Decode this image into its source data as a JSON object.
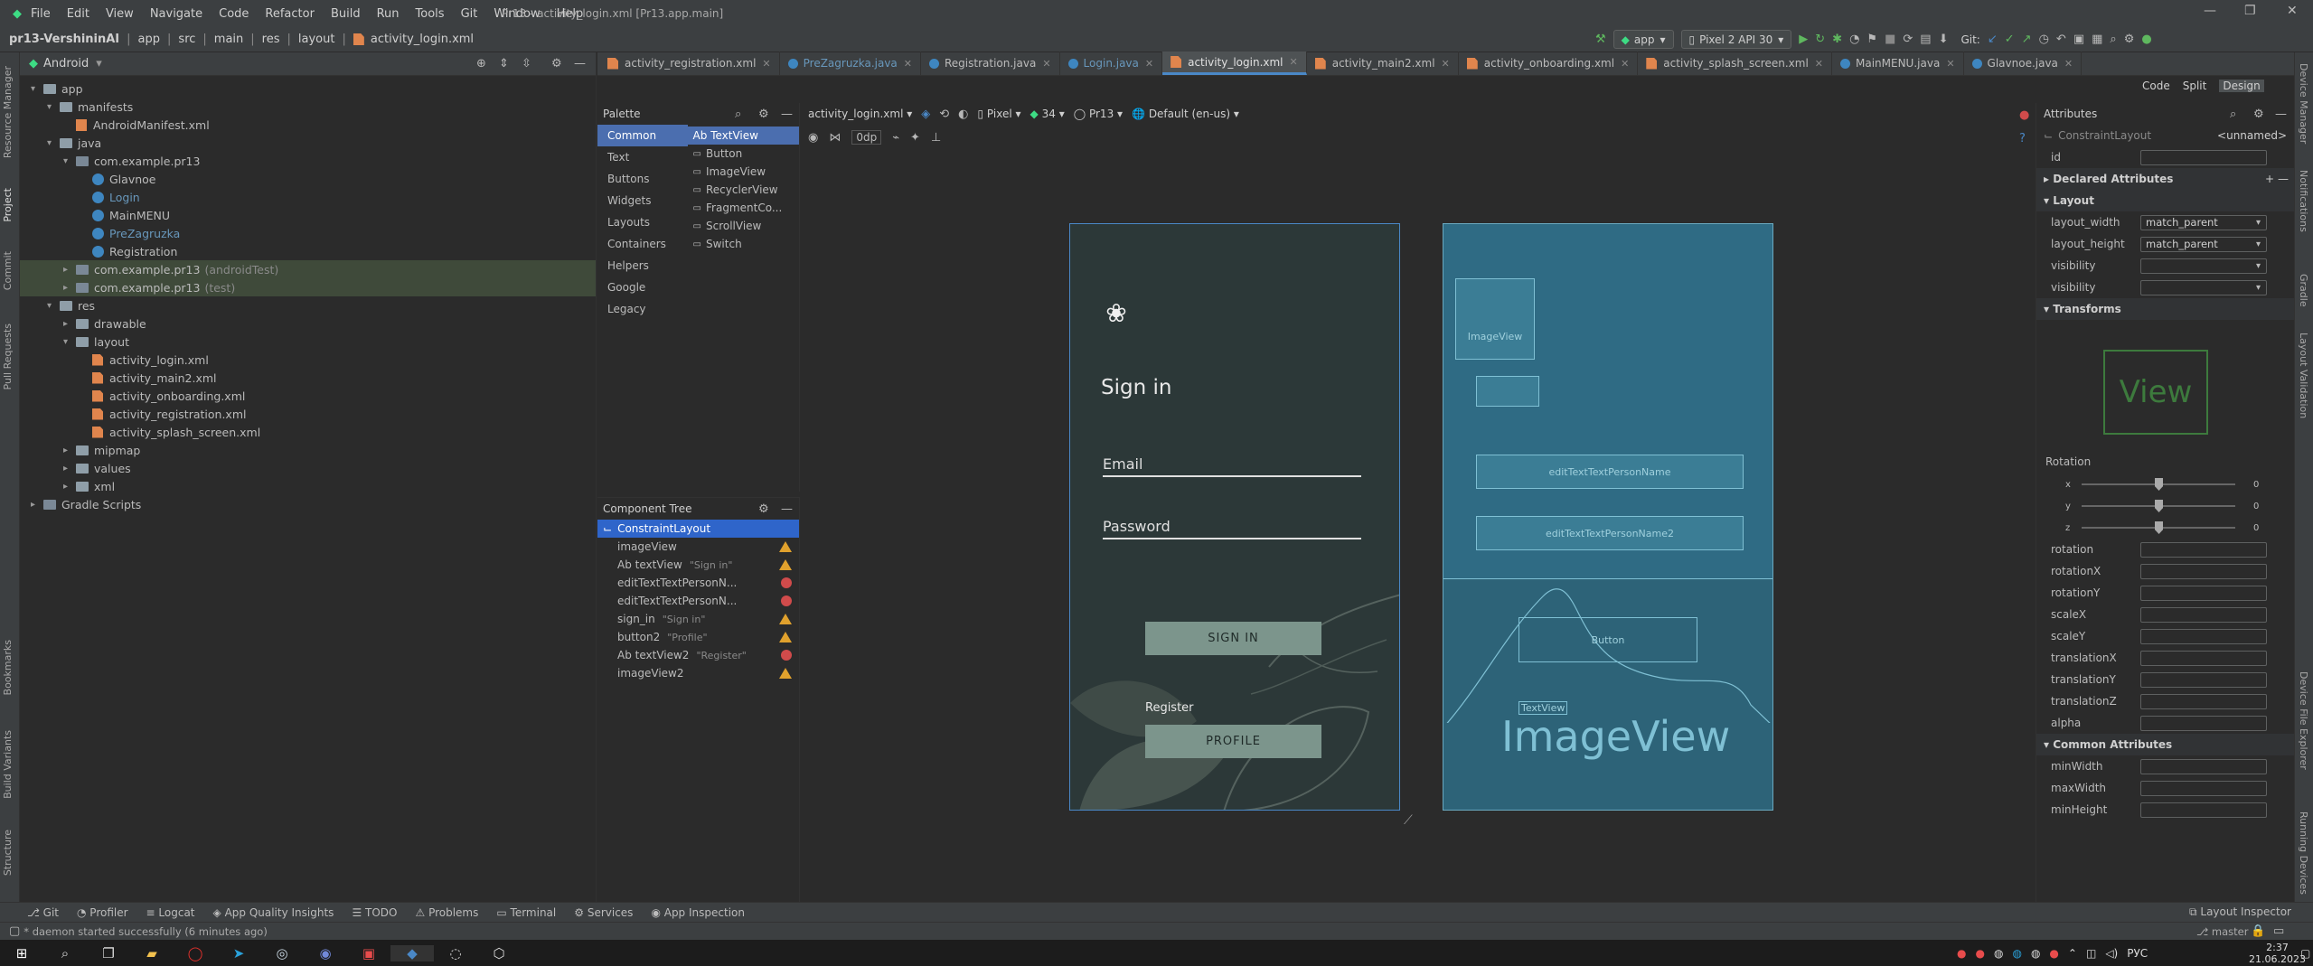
{
  "window": {
    "title": "Pr13 - activity_login.xml [Pr13.app.main]",
    "menu": [
      "File",
      "Edit",
      "View",
      "Navigate",
      "Code",
      "Refactor",
      "Build",
      "Run",
      "Tools",
      "Git",
      "Window",
      "Help"
    ]
  },
  "navbar": {
    "crumbs": [
      "pr13-VershininAI",
      "app",
      "src",
      "main",
      "res",
      "layout",
      "activity_login.xml"
    ],
    "run_config": "app",
    "device": "Pixel 2 API 30",
    "git_label": "Git:"
  },
  "project": {
    "view_label": "Android",
    "tree": [
      {
        "label": "app",
        "depth": 0,
        "type": "folder",
        "open": true
      },
      {
        "label": "manifests",
        "depth": 1,
        "type": "folder",
        "open": true
      },
      {
        "label": "AndroidManifest.xml",
        "depth": 2,
        "type": "manifest"
      },
      {
        "label": "java",
        "depth": 1,
        "type": "folder",
        "open": true
      },
      {
        "label": "com.example.pr13",
        "depth": 2,
        "type": "package",
        "open": true
      },
      {
        "label": "Glavnoe",
        "depth": 3,
        "type": "java"
      },
      {
        "label": "Login",
        "depth": 3,
        "type": "java",
        "color": "#6897bb"
      },
      {
        "label": "MainMENU",
        "depth": 3,
        "type": "java"
      },
      {
        "label": "PreZagruzka",
        "depth": 3,
        "type": "java",
        "color": "#6897bb"
      },
      {
        "label": "Registration",
        "depth": 3,
        "type": "java"
      },
      {
        "label": "com.example.pr13",
        "suffix": "(androidTest)",
        "depth": 2,
        "type": "package",
        "selected": true
      },
      {
        "label": "com.example.pr13",
        "suffix": "(test)",
        "depth": 2,
        "type": "package",
        "selected": true
      },
      {
        "label": "res",
        "depth": 1,
        "type": "folder",
        "open": true
      },
      {
        "label": "drawable",
        "depth": 2,
        "type": "folder"
      },
      {
        "label": "layout",
        "depth": 2,
        "type": "folder",
        "open": true
      },
      {
        "label": "activity_login.xml",
        "depth": 3,
        "type": "xml"
      },
      {
        "label": "activity_main2.xml",
        "depth": 3,
        "type": "xml"
      },
      {
        "label": "activity_onboarding.xml",
        "depth": 3,
        "type": "xml"
      },
      {
        "label": "activity_registration.xml",
        "depth": 3,
        "type": "xml"
      },
      {
        "label": "activity_splash_screen.xml",
        "depth": 3,
        "type": "xml"
      },
      {
        "label": "mipmap",
        "depth": 2,
        "type": "folder"
      },
      {
        "label": "values",
        "depth": 2,
        "type": "folder"
      },
      {
        "label": "xml",
        "depth": 2,
        "type": "folder"
      },
      {
        "label": "Gradle Scripts",
        "depth": 0,
        "type": "gradle"
      }
    ]
  },
  "tabs": [
    {
      "label": "activity_registration.xml",
      "type": "xml"
    },
    {
      "label": "PreZagruzka.java",
      "type": "java",
      "color": "#6897bb"
    },
    {
      "label": "Registration.java",
      "type": "java"
    },
    {
      "label": "Login.java",
      "type": "java",
      "color": "#6897bb"
    },
    {
      "label": "activity_login.xml",
      "type": "xml",
      "active": true
    },
    {
      "label": "activity_main2.xml",
      "type": "xml"
    },
    {
      "label": "activity_onboarding.xml",
      "type": "xml"
    },
    {
      "label": "activity_splash_screen.xml",
      "type": "xml"
    },
    {
      "label": "MainMENU.java",
      "type": "java"
    },
    {
      "label": "Glavnoe.java",
      "type": "java"
    }
  ],
  "view_modes": [
    "Code",
    "Split",
    "Design"
  ],
  "palette": {
    "title": "Palette",
    "categories": [
      "Common",
      "Text",
      "Buttons",
      "Widgets",
      "Layouts",
      "Containers",
      "Helpers",
      "Google",
      "Legacy"
    ],
    "items": [
      "Ab TextView",
      "Button",
      "ImageView",
      "RecyclerView",
      "FragmentCo...",
      "ScrollView",
      "Switch"
    ]
  },
  "component_tree": {
    "title": "Component Tree",
    "root": "ConstraintLayout",
    "rows": [
      {
        "label": "imageView",
        "hint": "",
        "status": "warn"
      },
      {
        "label": "Ab textView",
        "hint": "\"Sign in\"",
        "status": "warn"
      },
      {
        "label": "editTextTextPersonN...",
        "hint": "",
        "status": "err"
      },
      {
        "label": "editTextTextPersonN...",
        "hint": "",
        "status": "err"
      },
      {
        "label": "sign_in",
        "hint": "\"Sign in\"",
        "status": "warn"
      },
      {
        "label": "button2",
        "hint": "\"Profile\"",
        "status": "warn"
      },
      {
        "label": "Ab textView2",
        "hint": "\"Register\"",
        "status": "err"
      },
      {
        "label": "imageView2",
        "hint": "",
        "status": "warn"
      }
    ]
  },
  "designbar": {
    "file": "activity_login.xml",
    "device": "Pixel",
    "api": "34",
    "theme": "Pr13",
    "locale": "Default (en-us)",
    "margin": "0dp"
  },
  "screen": {
    "title": "Sign in",
    "email": "Email",
    "password": "Password",
    "sign_in": "SIGN IN",
    "register": "Register",
    "profile": "PROFILE"
  },
  "blueprint": {
    "imageview_small": "ImageView",
    "edit1": "editTextTextPersonName",
    "edit2": "editTextTextPersonName2",
    "button": "Button",
    "textview": "TextView",
    "imageview_big": "ImageView"
  },
  "attributes": {
    "title": "Attributes",
    "component": "ConstraintLayout",
    "name": "<unnamed>",
    "id_label": "id",
    "sections": {
      "declared": "Declared Attributes",
      "layout": "Layout",
      "transforms": "Transforms",
      "common": "Common Attributes"
    },
    "layout_rows": [
      {
        "label": "layout_width",
        "value": "match_parent"
      },
      {
        "label": "layout_height",
        "value": "match_parent"
      },
      {
        "label": "visibility",
        "value": ""
      },
      {
        "label": "visibility",
        "value": ""
      }
    ],
    "view_preview": "View",
    "rotation_label": "Rotation",
    "axes": [
      {
        "axis": "x",
        "value": "0"
      },
      {
        "axis": "y",
        "value": "0"
      },
      {
        "axis": "z",
        "value": "0"
      }
    ],
    "transform_rows": [
      "rotation",
      "rotationX",
      "rotationY",
      "scaleX",
      "scaleY",
      "translationX",
      "translationY",
      "translationZ",
      "alpha"
    ],
    "common_rows": [
      "minWidth",
      "maxWidth",
      "minHeight"
    ]
  },
  "bottombar": {
    "tools": [
      "Git",
      "Profiler",
      "Logcat",
      "App Quality Insights",
      "TODO",
      "Problems",
      "Terminal",
      "Services",
      "App Inspection"
    ],
    "layout_inspector": "Layout Inspector"
  },
  "statusbar": {
    "message": "* daemon started successfully (6 minutes ago)",
    "branch": "master"
  },
  "taskbar": {
    "time": "2:37",
    "date": "21.06.2023",
    "lang": "РУС"
  },
  "side_tabs": {
    "left": [
      "Resource Manager",
      "Project",
      "Commit",
      "Pull Requests",
      "Bookmarks",
      "Build Variants",
      "Structure"
    ],
    "right": [
      "Device Manager",
      "Notifications",
      "Gradle",
      "Layout Validation",
      "Device File Explorer",
      "Running Devices"
    ]
  }
}
